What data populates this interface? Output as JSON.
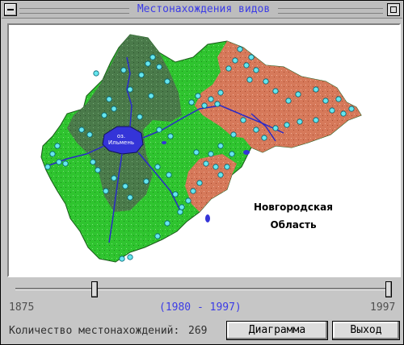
{
  "window": {
    "title": "Местонахождения видов"
  },
  "map": {
    "region_label_line1": "Новгородская",
    "region_label_line2": "Область",
    "lake_label_line1": "оз.",
    "lake_label_line2": "Ильмень",
    "colors": {
      "green_light": "#33cc33",
      "green_dark": "#4a7a4a",
      "red_brown": "#d9785a",
      "water": "#3333cc",
      "points": "#66e6ee"
    }
  },
  "timeline": {
    "min_year": "1875",
    "max_year": "1997",
    "selected_range": "(1980 - 1997)",
    "selected_start_fraction": 0.21,
    "selected_end_fraction": 1.0
  },
  "status": {
    "count_label": "Количество местонахождений:",
    "count_value": "269"
  },
  "buttons": {
    "diagram": "Диаграмма",
    "exit": "Выход"
  },
  "icons": {
    "system_menu": "system-menu-icon",
    "maximize": "maximize-icon"
  }
}
